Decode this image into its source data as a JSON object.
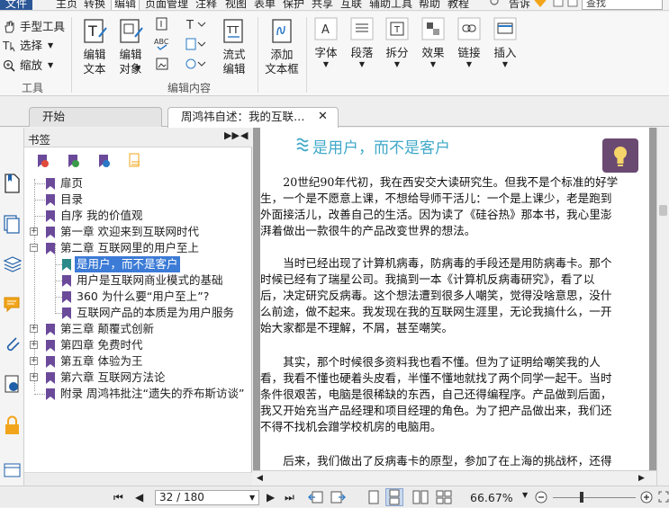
{
  "menu": {
    "file": "文件",
    "items": [
      "主页",
      "转换",
      "编辑",
      "页面管理",
      "注释",
      "视图",
      "表单",
      "保护",
      "共享",
      "互联",
      "辅助工具",
      "帮助",
      "教程"
    ],
    "active_index": 2,
    "tell": "告诉",
    "search_value": "查找"
  },
  "ribbon": {
    "tools": {
      "hand": "手型工具",
      "select": "选择",
      "zoom": "缩放",
      "group": "工具"
    },
    "edit_content": {
      "edit_text": [
        "编辑",
        "文本"
      ],
      "edit_object": [
        "编辑",
        "对象"
      ],
      "flow_edit": [
        "流式",
        "编辑"
      ],
      "add_textbox": [
        "添加",
        "文本框"
      ],
      "group": "编辑内容"
    },
    "format": {
      "font": "字体",
      "paragraph": "段落",
      "split": "拆分",
      "effect": "效果",
      "link": "链接",
      "insert": "插入"
    }
  },
  "tabs": [
    {
      "label": "开始"
    },
    {
      "label": "周鸿祎自述：我的互联…"
    }
  ],
  "bookmarks": {
    "title": "书签",
    "items": [
      {
        "label": "扉页"
      },
      {
        "label": "目录"
      },
      {
        "label": "自序 我的价值观"
      },
      {
        "label": "第一章 欢迎来到互联网时代"
      },
      {
        "label": "第二章 互联网里的用户至上"
      },
      {
        "label": "是用户，而不是客户"
      },
      {
        "label": "用户是互联网商业模式的基础"
      },
      {
        "label": "360 为什么要“用户至上”?"
      },
      {
        "label": "互联网产品的本质是为用户服务"
      },
      {
        "label": "第三章 颠覆式创新"
      },
      {
        "label": "第四章 免费时代"
      },
      {
        "label": "第五章 体验为王"
      },
      {
        "label": "第六章 互联网方法论"
      },
      {
        "label": "附录 周鸿祎批注“遗失的乔布斯访谈”"
      }
    ]
  },
  "document": {
    "heading": "是用户，而不是客户",
    "lines": [
      "　　20世纪90年代初，我在西安交大读研究生。但我不是个标准的好学",
      "生，一个是不愿意上课，不想给导师干活儿：一个是上课少，老是跑到",
      "外面接活儿，改善自己的生活。因为读了《硅谷热》那本书，我心里澎",
      "湃着做出一款很牛的产品改变世界的想法。",
      "　　当时已经出现了计算机病毒，防病毒的手段还是用防病毒卡。那个",
      "时候已经有了瑞星公司。我搞到一本《计算机反病毒研究》，看了以",
      "后，决定研究反病毒。这个想法遭到很多人嘲笑，觉得没啥意思，没什",
      "么前途，做不起来。我发现在我的互联网生涯里，无论我搞什么，一开",
      "始大家都是不理解，不屑，甚至嘲笑。",
      "　　其实，那个时候很多资料我也看不懂。但为了证明给嘲笑我的人",
      "看，我看不懂也硬着头皮看，半懂不懂地就找了两个同学一起干。当时",
      "条件很艰苦，电脑是很稀缺的东西，自己还得编程序。产品做到后面，",
      "我又开始充当产品经理和项目经理的角色。为了把产品做出来，我们还",
      "不得不找机会蹭学校机房的电脑用。",
      "　　后来，我们做出了反病毒卡的原型，参加了在上海的挑战杯，还得"
    ]
  },
  "status": {
    "page_value": "32 / 180",
    "zoom": "66.67%"
  }
}
